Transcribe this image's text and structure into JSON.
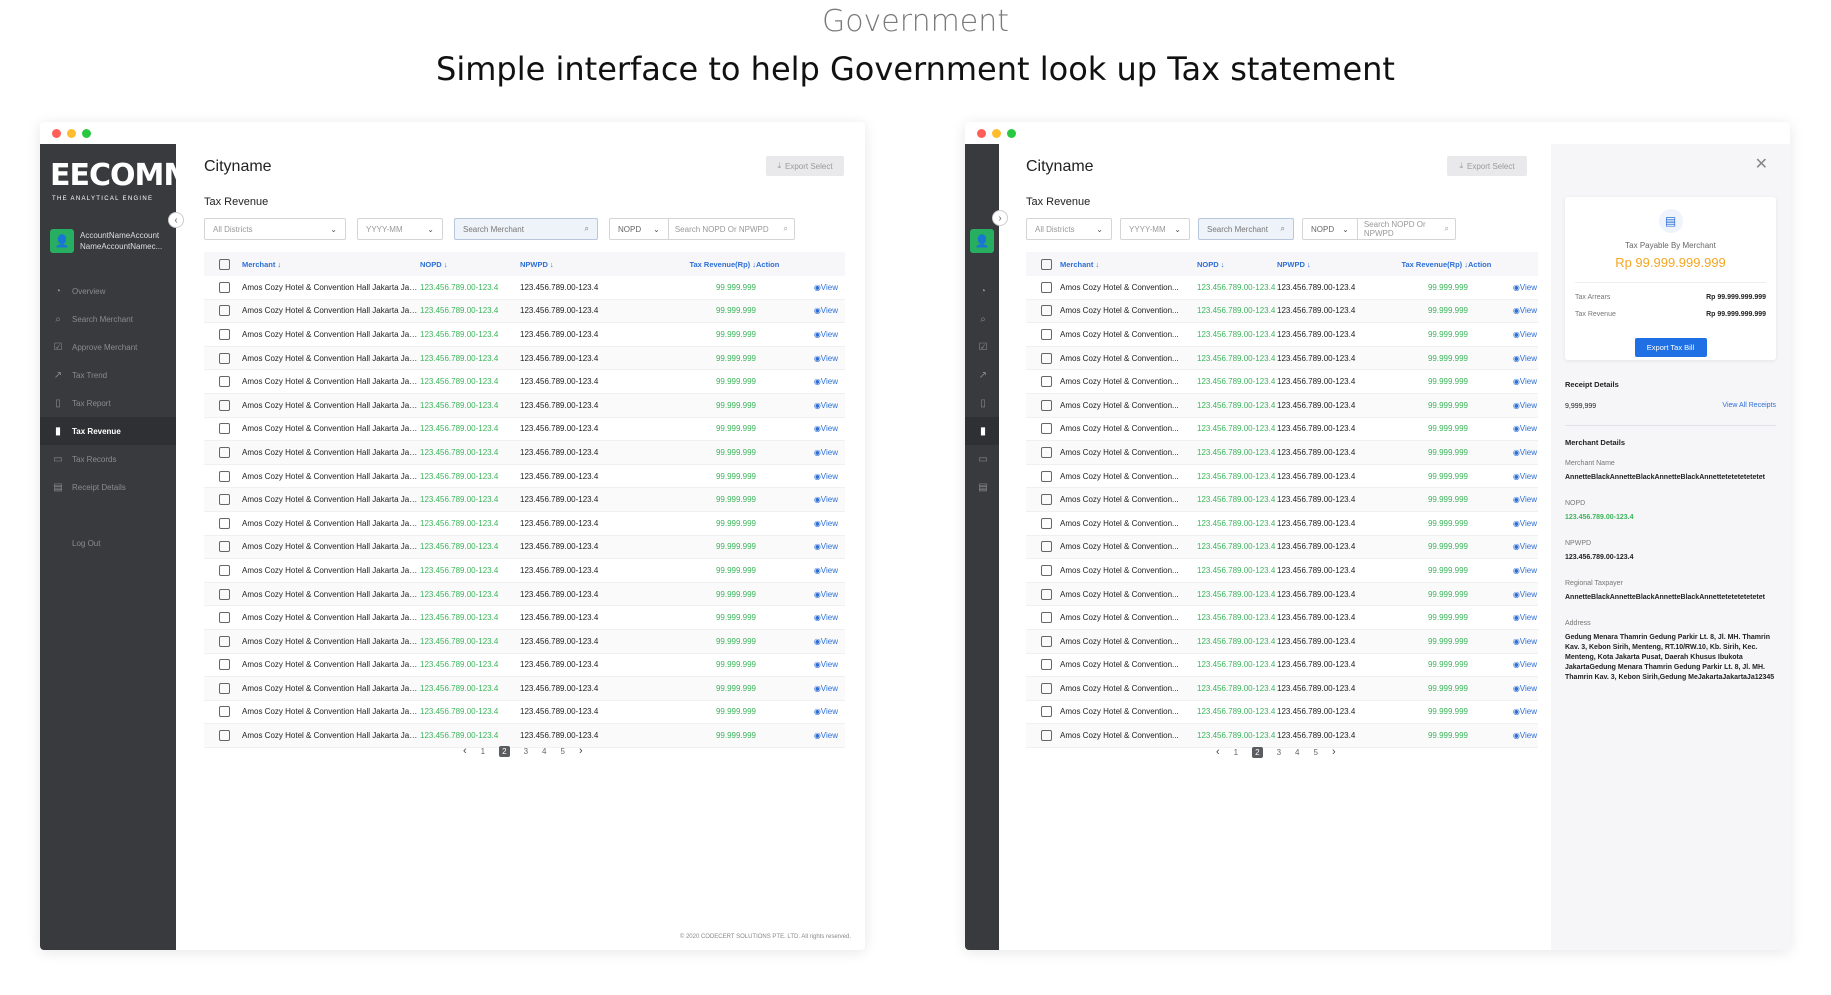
{
  "heading": {
    "sub": "Government",
    "main": "Simple interface to help Government look up Tax statement"
  },
  "app": {
    "logo": "EECOMM",
    "logo_sub": "THE ANALYTICAL ENGINE",
    "account_name": "AccountNameAccount NameAccountNamec...",
    "menu": [
      {
        "label": "Overview",
        "icon": "pie-chart-icon",
        "glyph": "◔"
      },
      {
        "label": "Search Merchant",
        "icon": "search-icon",
        "glyph": "⌕"
      },
      {
        "label": "Approve Merchant",
        "icon": "check-square-icon",
        "glyph": "☑"
      },
      {
        "label": "Tax Trend",
        "icon": "trend-icon",
        "glyph": "↗"
      },
      {
        "label": "Tax Report",
        "icon": "book-icon",
        "glyph": "▯"
      },
      {
        "label": "Tax Revenue",
        "icon": "bar-chart-icon",
        "glyph": "▮"
      },
      {
        "label": "Tax Records",
        "icon": "database-icon",
        "glyph": "▭"
      },
      {
        "label": "Receipt Details",
        "icon": "receipt-icon",
        "glyph": "▤"
      }
    ],
    "active_index": 5,
    "logout": "Log Out",
    "city": "Cityname",
    "section": "Tax Revenue",
    "export_select": "Export Select",
    "filters": {
      "district": "All Districts",
      "month": "YYYY-MM",
      "search_merchant": "Search Merchant",
      "nopd": "NOPD",
      "search_nopd": "Search NOPD Or NPWPD"
    },
    "columns": {
      "merchant": "Merchant ↓",
      "nopd": "NOPD ↓",
      "npwpd": "NPWPD ↓",
      "revenue": "Tax Revenue(Rp) ↓",
      "action": "Action"
    },
    "row": {
      "merchant_full": "Amos Cozy Hotel & Convention Hall Jakarta Jakartai",
      "merchant_short": "Amos Cozy Hotel & Convention...",
      "nopd": "123.456.789.00-123.4",
      "npwpd": "123.456.789.00-123.4",
      "revenue": "99.999.999",
      "action": "View"
    },
    "row_count": 20,
    "pagination": [
      "1",
      "2",
      "3",
      "4",
      "5"
    ],
    "active_page": "2",
    "footer": "© 2020 CODECERT SOLUTIONS PTE. LTD. All rights reserved."
  },
  "detail": {
    "tax_payable_label": "Tax Payable By Merchant",
    "tax_payable_amount": "Rp 99.999.999.999",
    "tax_arrears_label": "Tax Arrears",
    "tax_arrears_value": "Rp 99.999.999.999",
    "tax_revenue_label": "Tax Revenue",
    "tax_revenue_value": "Rp 99.999.999.999",
    "export_bill": "Export Tax Bill",
    "receipt_title": "Receipt Details",
    "receipt_count": "9,999,999",
    "view_all": "View All Receipts",
    "merchant_title": "Merchant Details",
    "merchant_name_label": "Merchant Name",
    "merchant_name": "AnnetteBlackAnnetteBlackAnnetteBlackAnnettetetetetetetet",
    "nopd_label": "NOPD",
    "nopd": "123.456.789.00-123.4",
    "npwpd_label": "NPWPD",
    "npwpd": "123.456.789.00-123.4",
    "regional_label": "Regional Taxpayer",
    "regional": "AnnetteBlackAnnetteBlackAnnetteBlackAnnettetetetetetetet",
    "address_label": "Address",
    "address": "Gedung Menara Thamrin Gedung Parkir Lt. 8, Jl. MH. Thamrin Kav. 3, Kebon Sirih, Menteng, RT.10/RW.10, Kb. Sirih, Kec. Menteng, Kota Jakarta Pusat, Daerah Khusus Ibukota JakartaGedung Menara Thamrin Gedung Parkir Lt. 8, Jl. MH. Thamrin Kav. 3, Kebon Sirih,Gedung MeJakartaJakartaJa12345"
  },
  "colors": {
    "accent": "#1f6fe5",
    "green": "#3cb55b",
    "orange": "#f5a623",
    "sidebar": "#393a3e"
  }
}
